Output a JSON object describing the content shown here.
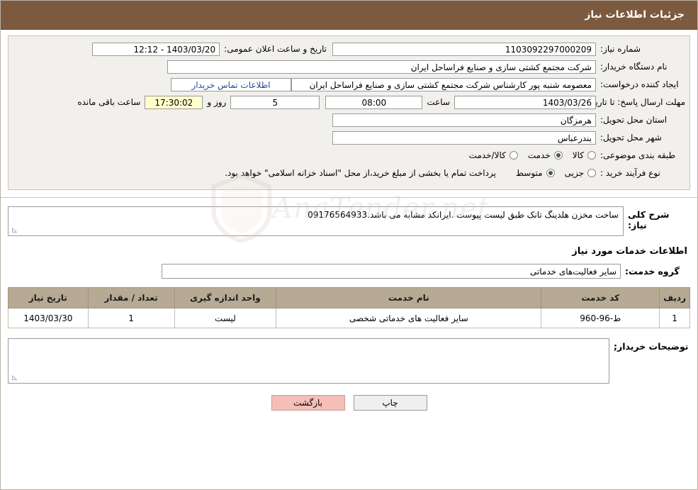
{
  "header": {
    "title": "جزئیات اطلاعات نیاز"
  },
  "details": {
    "need_number_label": "شماره نیاز:",
    "need_number_value": "1103092297000209",
    "announce_datetime_label": "تاریخ و ساعت اعلان عمومی:",
    "announce_datetime_value": "1403/03/20 - 12:12",
    "buyer_org_label": "نام دستگاه خریدار:",
    "buyer_org_value": "شرکت مجتمع کشتی سازی و صنایع فراساحل ایران",
    "creator_label": "ایجاد کننده درخواست:",
    "creator_value": "معصومه شنبه پور کارشناس شرکت مجتمع کشتی سازی و صنایع فراساحل ایران",
    "contact_link": "اطلاعات تماس خریدار",
    "deadline_label": "مهلت ارسال پاسخ: تا تاریخ:",
    "deadline_value": "1403/03/26",
    "hour_label": "ساعت",
    "hour_value": "08:00",
    "days_value": "5",
    "days_label": "روز و",
    "timer_value": "17:30:02",
    "remaining_label": "ساعت باقی مانده",
    "province_label": "استان محل تحویل:",
    "province_value": "هرمزگان",
    "city_label": "شهر محل تحویل:",
    "city_value": "بندرعباس",
    "category_label": "طبقه بندی موضوعی:",
    "category_options": [
      {
        "label": "کالا",
        "checked": false
      },
      {
        "label": "خدمت",
        "checked": true
      },
      {
        "label": "کالا/خدمت",
        "checked": false
      }
    ],
    "process_label": "نوع فرآیند خرید :",
    "process_options": [
      {
        "label": "جزیی",
        "checked": false
      },
      {
        "label": "متوسط",
        "checked": true
      }
    ],
    "process_note": "پرداخت تمام یا بخشی از مبلغ خرید،از محل \"اسناد خزانه اسلامی\" خواهد بود."
  },
  "need_description": {
    "label": "شرح کلی نیاز:",
    "value": "ساخت مخزن هلدینگ تانک طبق لیست پیوست .ایرانکد مشابه می باشد.09176564933"
  },
  "services_section": {
    "title": "اطلاعات خدمات مورد نیاز",
    "group_label": "گروه خدمت:",
    "group_value": "سایر فعالیت‌های خدماتی",
    "table": {
      "headers": [
        "ردیف",
        "کد خدمت",
        "نام خدمت",
        "واحد اندازه گیری",
        "تعداد / مقدار",
        "تاریخ نیاز"
      ],
      "rows": [
        {
          "radif": "1",
          "code": "ط-96-960",
          "name": "سایر فعالیت های خدماتی شخصی",
          "unit": "لیست",
          "qty": "1",
          "date": "1403/03/30"
        }
      ]
    }
  },
  "buyer_notes": {
    "label": "توضیحات خریدار;",
    "value": ""
  },
  "buttons": {
    "print": "چاپ",
    "back": "بازگشت"
  },
  "watermark": {
    "text": "AnaTender.net"
  }
}
